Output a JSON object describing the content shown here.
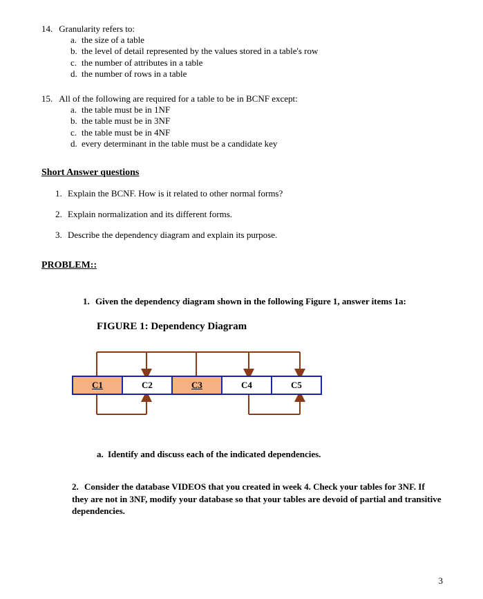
{
  "mcq": [
    {
      "num": "14.",
      "stem": "Granularity refers to:",
      "opts": [
        {
          "l": "a.",
          "t": "the size of a table"
        },
        {
          "l": "b.",
          "t": "the level of detail represented by the values stored in a table's row"
        },
        {
          "l": "c.",
          "t": "the number of attributes in a table"
        },
        {
          "l": "d.",
          "t": "the number of rows in a table"
        }
      ]
    },
    {
      "num": "15.",
      "stem": "All of the following are required for a table to be in BCNF except:",
      "opts": [
        {
          "l": "a.",
          "t": "the table must be in 1NF"
        },
        {
          "l": "b.",
          "t": "the table must be in 3NF"
        },
        {
          "l": "c.",
          "t": "the table must be in 4NF"
        },
        {
          "l": "d.",
          "t": "every determinant in the table must be a candidate key"
        }
      ]
    }
  ],
  "sa_heading": "Short Answer questions",
  "sa": [
    {
      "n": "1.",
      "t": "Explain the BCNF.  How is it related to other normal forms?"
    },
    {
      "n": "2.",
      "t": "Explain normalization and its different forms."
    },
    {
      "n": "3.",
      "t": "Describe the dependency diagram and explain its purpose."
    }
  ],
  "prob_heading": "PROBLEM::",
  "p1": {
    "n": "1.",
    "t": "Given the dependency diagram shown in the following Figure 1, answer items  1a:"
  },
  "fig_title": "FIGURE 1:  Dependency Diagram",
  "cells": {
    "c1": "C1",
    "c2": "C2",
    "c3": "C3",
    "c4": "C4",
    "c5": "C5"
  },
  "dependencies": [
    {
      "determinant": [
        "C1",
        "C3"
      ],
      "dependents": [
        "C2",
        "C4",
        "C5"
      ],
      "pos": "top"
    },
    {
      "determinant": [
        "C1"
      ],
      "dependents": [
        "C2"
      ],
      "pos": "bottom"
    },
    {
      "determinant": [
        "C4"
      ],
      "dependents": [
        "C5"
      ],
      "pos": "bottom"
    }
  ],
  "sub_a": {
    "n": "a.",
    "t": "Identify and discuss each of the indicated  dependencies."
  },
  "p2": {
    "n": "2.",
    "t": "Consider the database VIDEOS that you created in week 4. Check your tables for 3NF. If they are not in 3NF, modify your database so that your tables are devoid of partial and transitive dependencies."
  },
  "page_num": "3"
}
